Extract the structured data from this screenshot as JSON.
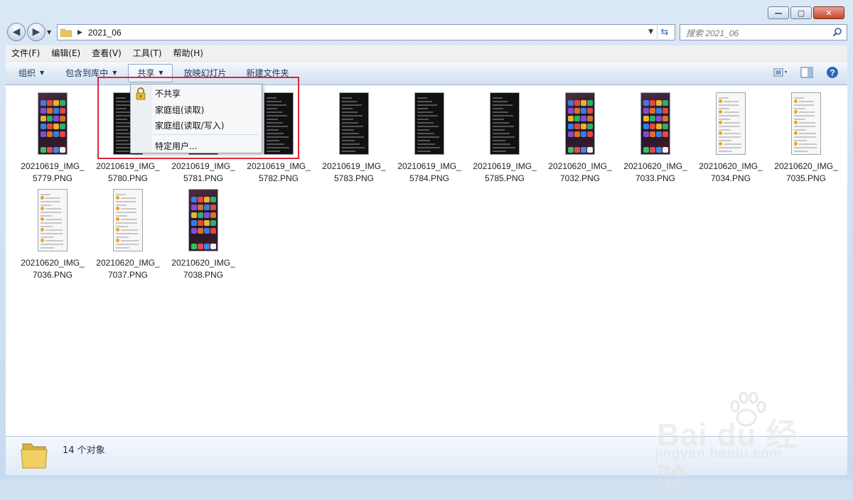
{
  "window": {
    "caption": {
      "minimize": "—",
      "maximize": "▢",
      "close": "✕"
    }
  },
  "nav": {
    "back": "◀",
    "forward": "▶",
    "path": "2021_06",
    "search_placeholder": "搜索 2021_06"
  },
  "menubar": [
    "文件(F)",
    "编辑(E)",
    "查看(V)",
    "工具(T)",
    "帮助(H)"
  ],
  "toolbar": {
    "organize": "组织",
    "include_in_library": "包含到库中",
    "share": "共享",
    "slideshow": "放映幻灯片",
    "new_folder": "新建文件夹"
  },
  "share_menu": {
    "items": [
      "不共享",
      "家庭组(读取)",
      "家庭组(读取/写入)",
      "特定用户..."
    ]
  },
  "files": [
    {
      "name": "20210619_IMG_\n5779.PNG",
      "thumb": "home"
    },
    {
      "name": "20210619_IMG_\n5780.PNG",
      "thumb": "dark"
    },
    {
      "name": "20210619_IMG_\n5781.PNG",
      "thumb": "dark"
    },
    {
      "name": "20210619_IMG_\n5782.PNG",
      "thumb": "dark"
    },
    {
      "name": "20210619_IMG_\n5783.PNG",
      "thumb": "dark"
    },
    {
      "name": "20210619_IMG_\n5784.PNG",
      "thumb": "dark"
    },
    {
      "name": "20210619_IMG_\n5785.PNG",
      "thumb": "dark"
    },
    {
      "name": "20210620_IMG_\n7032.PNG",
      "thumb": "home"
    },
    {
      "name": "20210620_IMG_\n7033.PNG",
      "thumb": "home"
    },
    {
      "name": "20210620_IMG_\n7034.PNG",
      "thumb": "light"
    },
    {
      "name": "20210620_IMG_\n7035.PNG",
      "thumb": "light"
    },
    {
      "name": "20210620_IMG_\n7036.PNG",
      "thumb": "light"
    },
    {
      "name": "20210620_IMG_\n7037.PNG",
      "thumb": "light"
    },
    {
      "name": "20210620_IMG_\n7038.PNG",
      "thumb": "home"
    }
  ],
  "status": {
    "count": "14 个对象"
  },
  "watermark": {
    "main": "Bai du 经验",
    "sub": "jingyan.baidu.com"
  },
  "colors": {
    "highlight_box": "#e0263a",
    "toolbar_text": "#1e395b"
  }
}
